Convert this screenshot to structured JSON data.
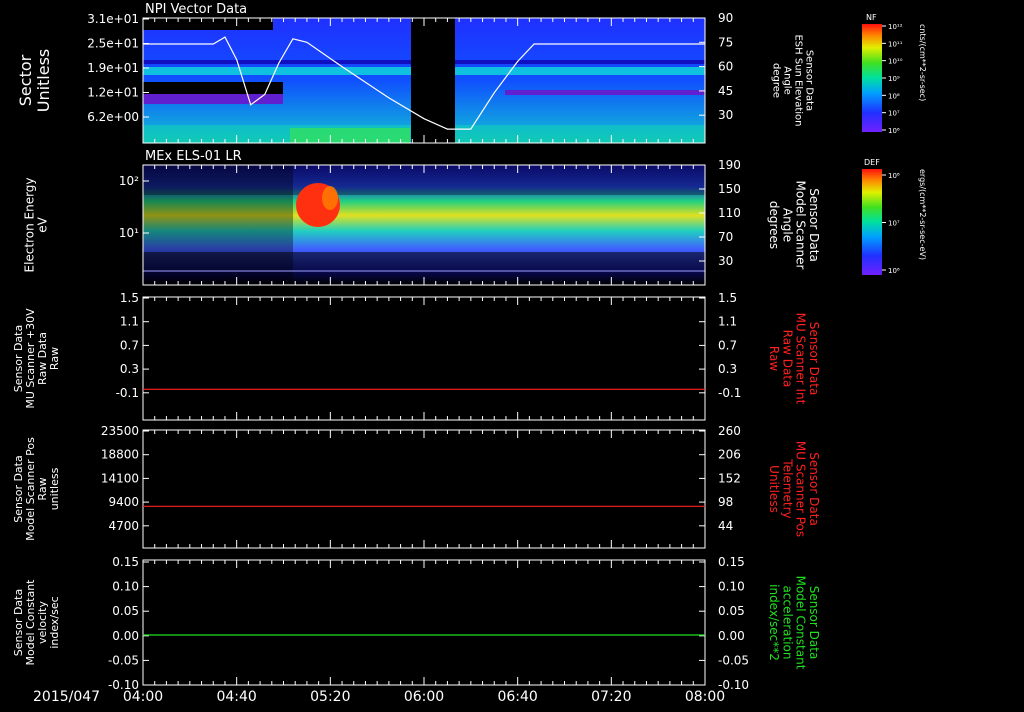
{
  "date_label": "2015/047",
  "time_ticks": [
    "04:00",
    "04:40",
    "05:20",
    "06:00",
    "06:40",
    "07:20",
    "08:00"
  ],
  "colors": {
    "white": "#ffffff",
    "red": "#ff2020",
    "green": "#20e020",
    "background": "#000000"
  },
  "chart_data": [
    {
      "type": "heatmap",
      "title": "NPI Vector Data",
      "ylabel": "Sector\nUnitless",
      "yticks": [
        "3.1e+01",
        "2.5e+01",
        "1.9e+01",
        "1.2e+01",
        "6.2e+00"
      ],
      "right_ylabel": "Sensor Data\nESH Sun Elevation\nAngle\ndegree",
      "right_yticks": [
        "90",
        "75",
        "60",
        "45",
        "30"
      ],
      "right_ylim": [
        18,
        90
      ],
      "colorbar": {
        "label": "NF",
        "unit": "cnts/(cm**2-sr-sec)",
        "ticks": [
          "10¹²",
          "10¹¹",
          "10¹⁰",
          "10⁹",
          "10⁸",
          "10⁷",
          "10⁶"
        ]
      },
      "overlay_line": {
        "x": [
          "04:00",
          "04:30",
          "04:35",
          "04:40",
          "04:46",
          "04:52",
          "04:58",
          "05:04",
          "05:10",
          "05:25",
          "05:45",
          "06:00",
          "06:10",
          "06:20",
          "06:30",
          "06:40",
          "06:47",
          "08:00"
        ],
        "y": [
          75,
          75,
          79,
          66,
          40,
          46,
          64,
          78,
          76,
          62,
          44,
          32,
          26,
          26,
          47,
          65,
          75,
          75
        ]
      },
      "data_gap": [
        "05:52",
        "06:10"
      ]
    },
    {
      "type": "heatmap",
      "title": "MEx ELS-01 LR",
      "ylabel": "Electron Energy\neV",
      "yticks": [
        "10²",
        "10¹"
      ],
      "right_ylabel": "Sensor Data\nModel Scanner\nAngle\ndegrees",
      "right_yticks": [
        "190",
        "150",
        "110",
        "70",
        "30"
      ],
      "colorbar": {
        "label": "DEF",
        "unit": "ergs/(cm**2-sr-sec-eV)",
        "ticks": [
          "10⁸",
          "10⁷",
          "10⁶"
        ]
      }
    },
    {
      "type": "line",
      "title": "",
      "ylabel": "Sensor Data\nMU Scanner +30V\nRaw Data\nRaw",
      "yticks": [
        "1.5",
        "1.1",
        "0.7",
        "0.3",
        "-0.1"
      ],
      "ylim": [
        -0.5,
        1.5
      ],
      "right_ylabel": "Sensor Data\nMU Scanner Int\nRaw Data\nRaw",
      "right_yticks": [
        "1.5",
        "1.1",
        "0.7",
        "0.3",
        "-0.1"
      ],
      "series": [
        {
          "x": [
            "04:00",
            "08:00"
          ],
          "y": [
            0.0,
            0.0
          ],
          "color": "#ff2020"
        }
      ]
    },
    {
      "type": "line",
      "title": "",
      "ylabel": "Sensor Data\nModel Scanner Pos\nRaw\nunitless",
      "yticks": [
        "23500",
        "18800",
        "14100",
        "9400",
        "4700"
      ],
      "ylim": [
        0,
        23500
      ],
      "right_ylabel": "Sensor Data\nMU Scanner Pos\nTelemetry\nUnitless",
      "right_yticks": [
        "260",
        "206",
        "152",
        "98",
        "44"
      ],
      "series": [
        {
          "x": [
            "04:00",
            "08:00"
          ],
          "y": [
            8300,
            8300
          ],
          "color": "#ff2020"
        }
      ]
    },
    {
      "type": "line",
      "title": "",
      "ylabel": "Sensor Data\nModel Constant\nvelocity\nindex/sec",
      "yticks": [
        "0.15",
        "0.10",
        "0.05",
        "0.00",
        "-0.05",
        "-0.10"
      ],
      "ylim": [
        -0.1,
        0.15
      ],
      "right_ylabel": "Sensor Data\nModel Constant\nacceleration\nindex/sec**2",
      "right_yticks": [
        "0.15",
        "0.10",
        "0.05",
        "0.00",
        "-0.05",
        "-0.10"
      ],
      "series": [
        {
          "x": [
            "04:00",
            "08:00"
          ],
          "y": [
            0.0,
            0.0
          ],
          "color": "#20e020"
        }
      ]
    }
  ]
}
